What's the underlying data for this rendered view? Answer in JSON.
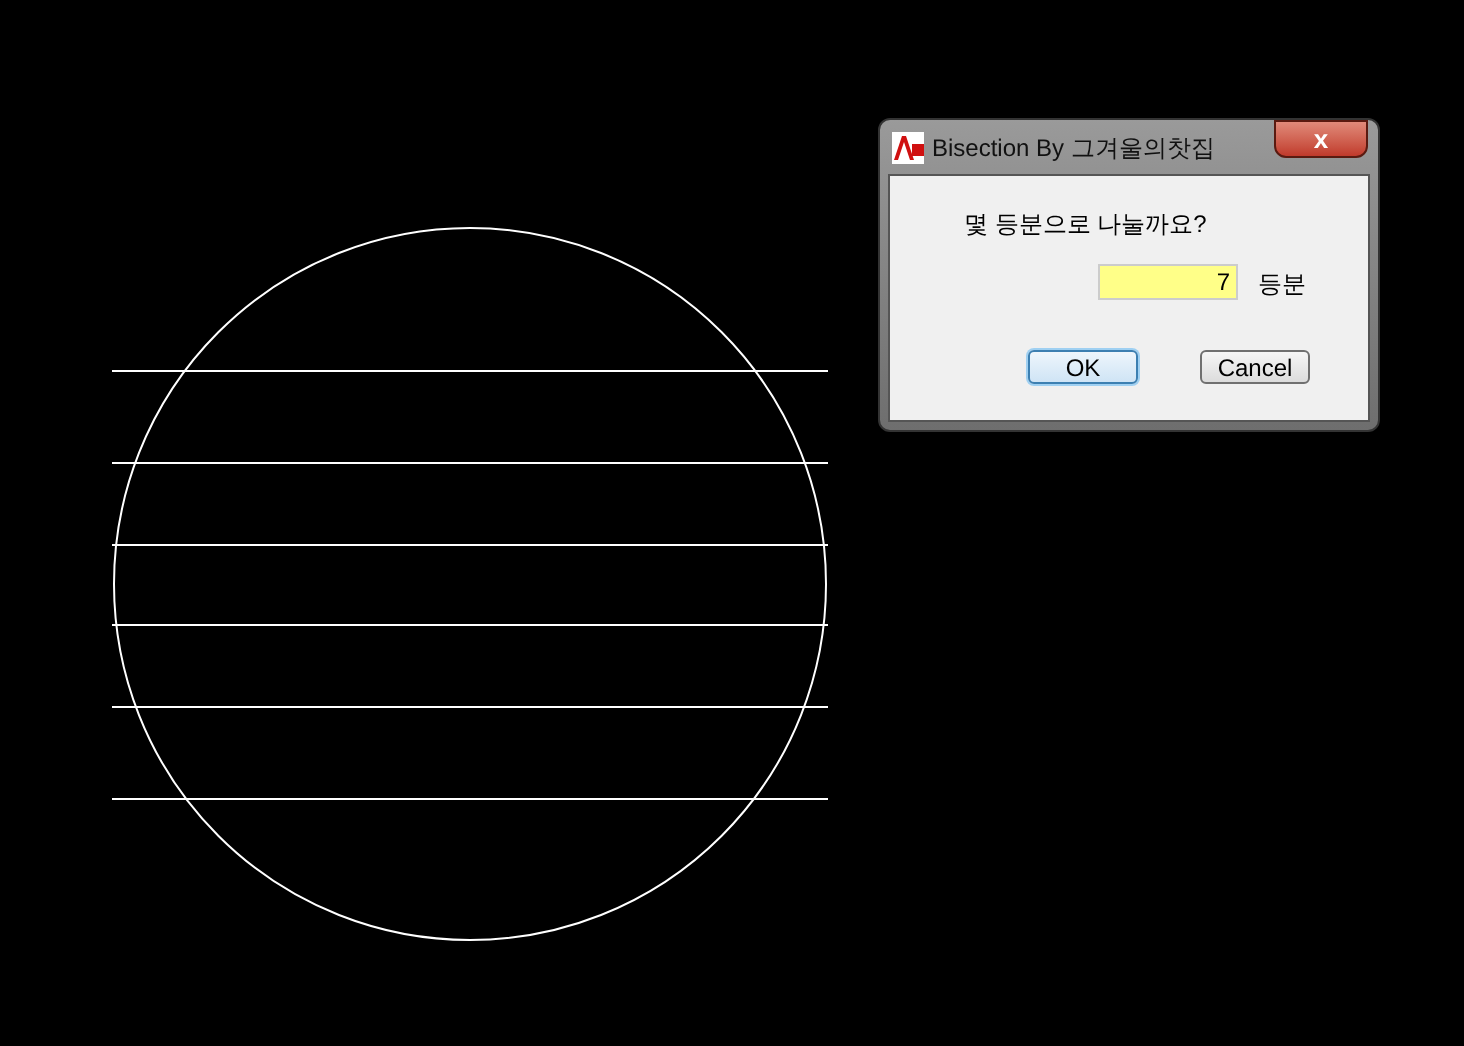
{
  "dialog": {
    "title": "Bisection By 그겨울의찻집",
    "close_label": "x",
    "prompt": "몇 등분으로 나눌까요?",
    "field": {
      "value": "7"
    },
    "unit": "등분",
    "buttons": [
      {
        "label": "OK",
        "selected": true
      },
      {
        "label": "Cancel",
        "selected": false
      }
    ]
  }
}
